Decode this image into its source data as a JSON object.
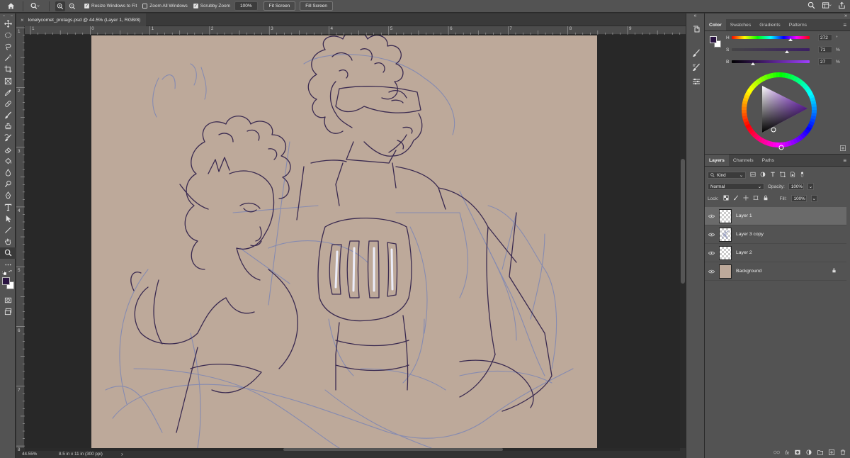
{
  "options_bar": {
    "home_icon": "home-icon",
    "tool_icon": "zoom-tool-icon",
    "resize_windows_label": "Resize Windows to Fit",
    "resize_windows_checked": true,
    "zoom_all_windows_label": "Zoom All Windows",
    "zoom_all_windows_checked": false,
    "scrubby_zoom_label": "Scrubby Zoom",
    "scrubby_zoom_checked": true,
    "zoom_value": "100%",
    "fit_screen_label": "Fit Screen",
    "fill_screen_label": "Fill Screen"
  },
  "document": {
    "tab_title": "lonelycomet_protags.psd @ 44.5% (Layer 1, RGB/8)",
    "close_symbol": "×"
  },
  "rulers": {
    "horizontal": [
      "1",
      "0",
      "1",
      "2",
      "3",
      "4",
      "5",
      "6",
      "7",
      "8",
      "9"
    ],
    "vertical": [
      "1",
      "2",
      "3",
      "4",
      "5",
      "6",
      "7",
      "8"
    ]
  },
  "status_bar": {
    "zoom": "44.55%",
    "doc_info": "8.5 in x 11 in (300 ppi)",
    "arrow": "›"
  },
  "color_panel": {
    "tabs": [
      "Color",
      "Swatches",
      "Gradients",
      "Patterns"
    ],
    "active_tab": "Color",
    "foreground_color": "#2a1442",
    "background_color": "#ffffff",
    "sliders": [
      {
        "label": "H",
        "value": "272",
        "unit": "°",
        "level": 0.756
      },
      {
        "label": "S",
        "value": "71",
        "unit": "%",
        "level": 0.71
      },
      {
        "label": "B",
        "value": "27",
        "unit": "%",
        "level": 0.27
      }
    ]
  },
  "layers_panel": {
    "tabs": [
      "Layers",
      "Channels",
      "Paths"
    ],
    "active_tab": "Layers",
    "filter_kind": "Kind",
    "blend_mode": "Normal",
    "opacity_label": "Opacity:",
    "opacity_value": "100%",
    "lock_label": "Lock:",
    "fill_label": "Fill:",
    "fill_value": "100%",
    "layers": [
      {
        "name": "Layer 1",
        "selected": true,
        "thumb": "transparent"
      },
      {
        "name": "Layer 3 copy",
        "selected": false,
        "thumb": "sketch"
      },
      {
        "name": "Layer 2",
        "selected": false,
        "thumb": "transparent"
      },
      {
        "name": "Background",
        "selected": false,
        "thumb": "#bda99a",
        "locked": true
      }
    ]
  },
  "colors": {
    "canvas": "#bda99a",
    "sketch_line": "#3a2a50",
    "sketch_blue": "#7d86b5",
    "glow": "#eef0ff"
  }
}
